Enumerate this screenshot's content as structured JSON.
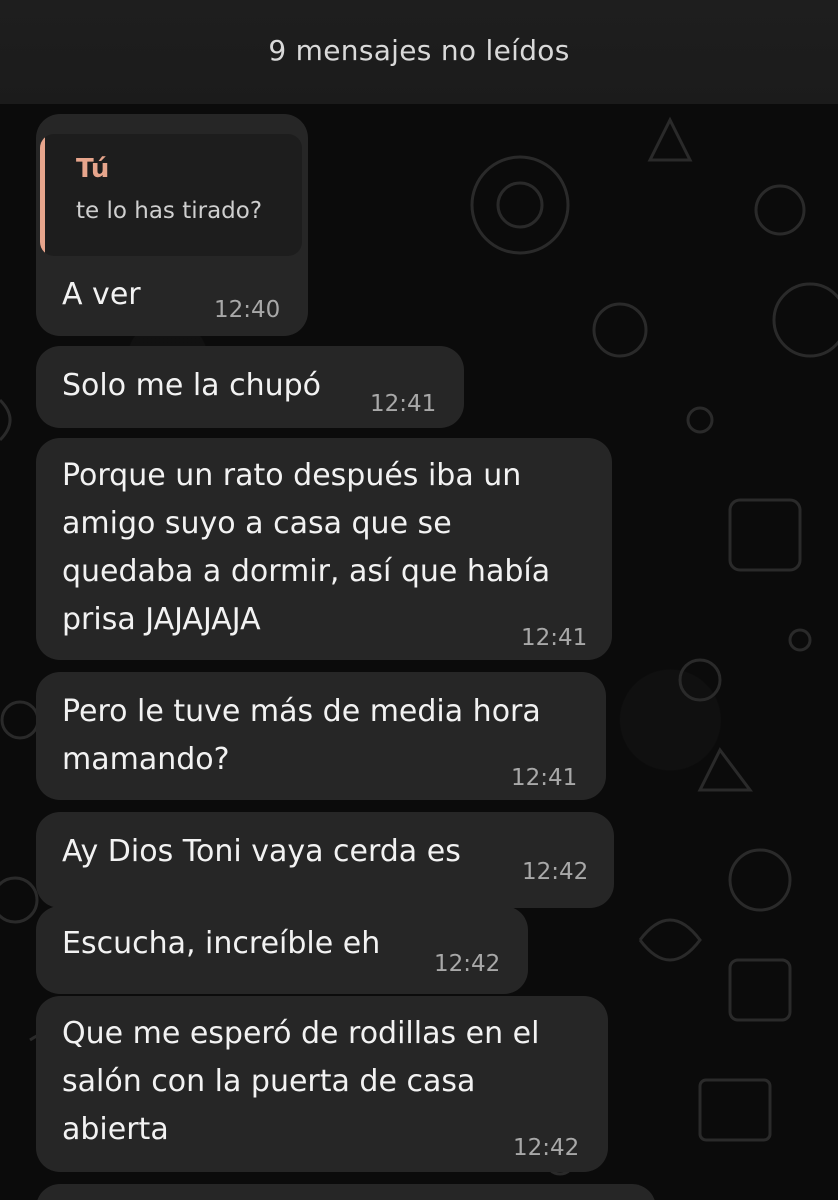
{
  "banner": {
    "unread_label": "9 mensajes no leídos"
  },
  "quote": {
    "author": "Tú",
    "text": "te lo has tirado?"
  },
  "messages": [
    {
      "text": "A ver",
      "time": "12:40"
    },
    {
      "text": "Solo me la chupó",
      "time": "12:41"
    },
    {
      "text": "Porque un rato después iba un\namigo suyo a casa que se\nquedaba a dormir, así que había\nprisa JAJAJAJA",
      "time": "12:41"
    },
    {
      "text": "Pero le tuve más de media hora\nmamando?",
      "time": "12:41"
    },
    {
      "text": "Ay Dios Toni vaya cerda es",
      "time": "12:42"
    },
    {
      "text": "Escucha, increíble eh",
      "time": "12:42"
    },
    {
      "text": "Que me esperó de rodillas en el\nsalón con la puerta de casa\nabierta",
      "time": "12:42"
    }
  ],
  "colors": {
    "background": "#0b0b0b",
    "bubble": "#262626",
    "quote_accent": "#e7a58c",
    "banner": "#1e1e1e"
  }
}
